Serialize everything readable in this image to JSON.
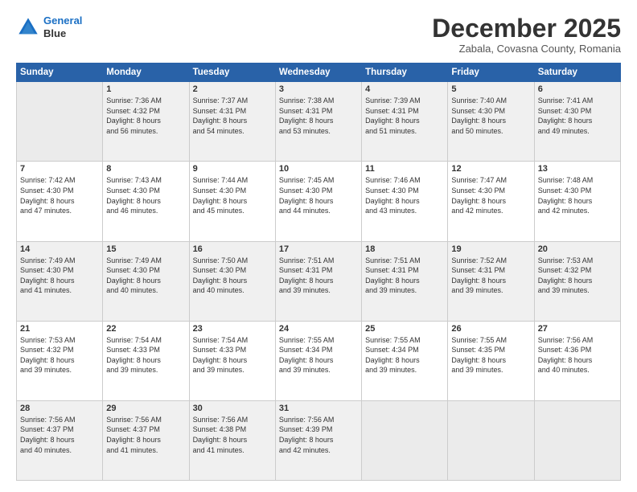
{
  "logo": {
    "line1": "General",
    "line2": "Blue"
  },
  "header": {
    "month": "December 2025",
    "location": "Zabala, Covasna County, Romania"
  },
  "weekdays": [
    "Sunday",
    "Monday",
    "Tuesday",
    "Wednesday",
    "Thursday",
    "Friday",
    "Saturday"
  ],
  "weeks": [
    [
      {
        "day": "",
        "info": ""
      },
      {
        "day": "1",
        "info": "Sunrise: 7:36 AM\nSunset: 4:32 PM\nDaylight: 8 hours\nand 56 minutes."
      },
      {
        "day": "2",
        "info": "Sunrise: 7:37 AM\nSunset: 4:31 PM\nDaylight: 8 hours\nand 54 minutes."
      },
      {
        "day": "3",
        "info": "Sunrise: 7:38 AM\nSunset: 4:31 PM\nDaylight: 8 hours\nand 53 minutes."
      },
      {
        "day": "4",
        "info": "Sunrise: 7:39 AM\nSunset: 4:31 PM\nDaylight: 8 hours\nand 51 minutes."
      },
      {
        "day": "5",
        "info": "Sunrise: 7:40 AM\nSunset: 4:30 PM\nDaylight: 8 hours\nand 50 minutes."
      },
      {
        "day": "6",
        "info": "Sunrise: 7:41 AM\nSunset: 4:30 PM\nDaylight: 8 hours\nand 49 minutes."
      }
    ],
    [
      {
        "day": "7",
        "info": "Sunrise: 7:42 AM\nSunset: 4:30 PM\nDaylight: 8 hours\nand 47 minutes."
      },
      {
        "day": "8",
        "info": "Sunrise: 7:43 AM\nSunset: 4:30 PM\nDaylight: 8 hours\nand 46 minutes."
      },
      {
        "day": "9",
        "info": "Sunrise: 7:44 AM\nSunset: 4:30 PM\nDaylight: 8 hours\nand 45 minutes."
      },
      {
        "day": "10",
        "info": "Sunrise: 7:45 AM\nSunset: 4:30 PM\nDaylight: 8 hours\nand 44 minutes."
      },
      {
        "day": "11",
        "info": "Sunrise: 7:46 AM\nSunset: 4:30 PM\nDaylight: 8 hours\nand 43 minutes."
      },
      {
        "day": "12",
        "info": "Sunrise: 7:47 AM\nSunset: 4:30 PM\nDaylight: 8 hours\nand 42 minutes."
      },
      {
        "day": "13",
        "info": "Sunrise: 7:48 AM\nSunset: 4:30 PM\nDaylight: 8 hours\nand 42 minutes."
      }
    ],
    [
      {
        "day": "14",
        "info": "Sunrise: 7:49 AM\nSunset: 4:30 PM\nDaylight: 8 hours\nand 41 minutes."
      },
      {
        "day": "15",
        "info": "Sunrise: 7:49 AM\nSunset: 4:30 PM\nDaylight: 8 hours\nand 40 minutes."
      },
      {
        "day": "16",
        "info": "Sunrise: 7:50 AM\nSunset: 4:30 PM\nDaylight: 8 hours\nand 40 minutes."
      },
      {
        "day": "17",
        "info": "Sunrise: 7:51 AM\nSunset: 4:31 PM\nDaylight: 8 hours\nand 39 minutes."
      },
      {
        "day": "18",
        "info": "Sunrise: 7:51 AM\nSunset: 4:31 PM\nDaylight: 8 hours\nand 39 minutes."
      },
      {
        "day": "19",
        "info": "Sunrise: 7:52 AM\nSunset: 4:31 PM\nDaylight: 8 hours\nand 39 minutes."
      },
      {
        "day": "20",
        "info": "Sunrise: 7:53 AM\nSunset: 4:32 PM\nDaylight: 8 hours\nand 39 minutes."
      }
    ],
    [
      {
        "day": "21",
        "info": "Sunrise: 7:53 AM\nSunset: 4:32 PM\nDaylight: 8 hours\nand 39 minutes."
      },
      {
        "day": "22",
        "info": "Sunrise: 7:54 AM\nSunset: 4:33 PM\nDaylight: 8 hours\nand 39 minutes."
      },
      {
        "day": "23",
        "info": "Sunrise: 7:54 AM\nSunset: 4:33 PM\nDaylight: 8 hours\nand 39 minutes."
      },
      {
        "day": "24",
        "info": "Sunrise: 7:55 AM\nSunset: 4:34 PM\nDaylight: 8 hours\nand 39 minutes."
      },
      {
        "day": "25",
        "info": "Sunrise: 7:55 AM\nSunset: 4:34 PM\nDaylight: 8 hours\nand 39 minutes."
      },
      {
        "day": "26",
        "info": "Sunrise: 7:55 AM\nSunset: 4:35 PM\nDaylight: 8 hours\nand 39 minutes."
      },
      {
        "day": "27",
        "info": "Sunrise: 7:56 AM\nSunset: 4:36 PM\nDaylight: 8 hours\nand 40 minutes."
      }
    ],
    [
      {
        "day": "28",
        "info": "Sunrise: 7:56 AM\nSunset: 4:37 PM\nDaylight: 8 hours\nand 40 minutes."
      },
      {
        "day": "29",
        "info": "Sunrise: 7:56 AM\nSunset: 4:37 PM\nDaylight: 8 hours\nand 41 minutes."
      },
      {
        "day": "30",
        "info": "Sunrise: 7:56 AM\nSunset: 4:38 PM\nDaylight: 8 hours\nand 41 minutes."
      },
      {
        "day": "31",
        "info": "Sunrise: 7:56 AM\nSunset: 4:39 PM\nDaylight: 8 hours\nand 42 minutes."
      },
      {
        "day": "",
        "info": ""
      },
      {
        "day": "",
        "info": ""
      },
      {
        "day": "",
        "info": ""
      }
    ]
  ]
}
